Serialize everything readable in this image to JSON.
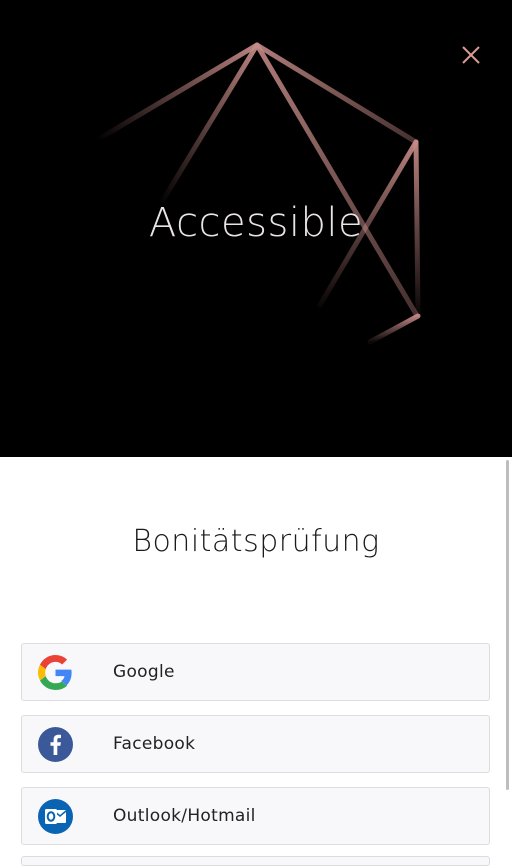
{
  "hero": {
    "title": "Accessible",
    "accent_color": "#c48a86"
  },
  "close": {
    "icon": "close-icon"
  },
  "sheet": {
    "title": "Bonitätsprüfung",
    "providers": [
      {
        "label": "Google",
        "icon": "google-logo-icon"
      },
      {
        "label": "Facebook",
        "icon": "facebook-logo-icon"
      },
      {
        "label": "Outlook/Hotmail",
        "icon": "outlook-logo-icon"
      }
    ]
  },
  "colors": {
    "hero_background": "#000000",
    "sheet_background": "#ffffff",
    "button_background": "#f8f8fa",
    "facebook_blue": "#3b5998",
    "outlook_blue": "#0a64b4"
  }
}
